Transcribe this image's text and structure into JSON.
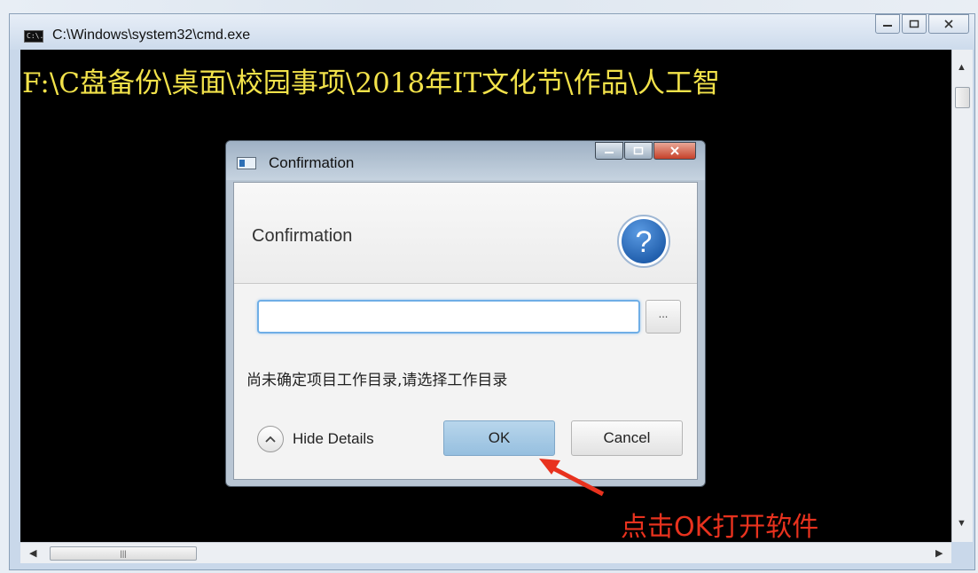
{
  "cmd_window": {
    "title": "C:\\Windows\\system32\\cmd.exe",
    "icon_label": "C:\\.",
    "console_text": "F:\\C盘备份\\桌面\\校园事项\\2018年IT文化节\\作品\\人工智"
  },
  "dialog": {
    "title": "Confirmation",
    "heading": "Confirmation",
    "help_icon_glyph": "?",
    "path_value": "",
    "browse_label": "...",
    "message": "尚未确定项目工作目录,请选择工作目录",
    "details_label": "Hide Details",
    "ok_label": "OK",
    "cancel_label": "Cancel"
  },
  "annotation": {
    "text": "点击OK打开软件",
    "color": "#e8321e"
  },
  "colors": {
    "console_bg": "#000000",
    "console_text": "#f2e24a",
    "ok_button": "#a6cbe6",
    "focus_ring": "#6faee6"
  }
}
